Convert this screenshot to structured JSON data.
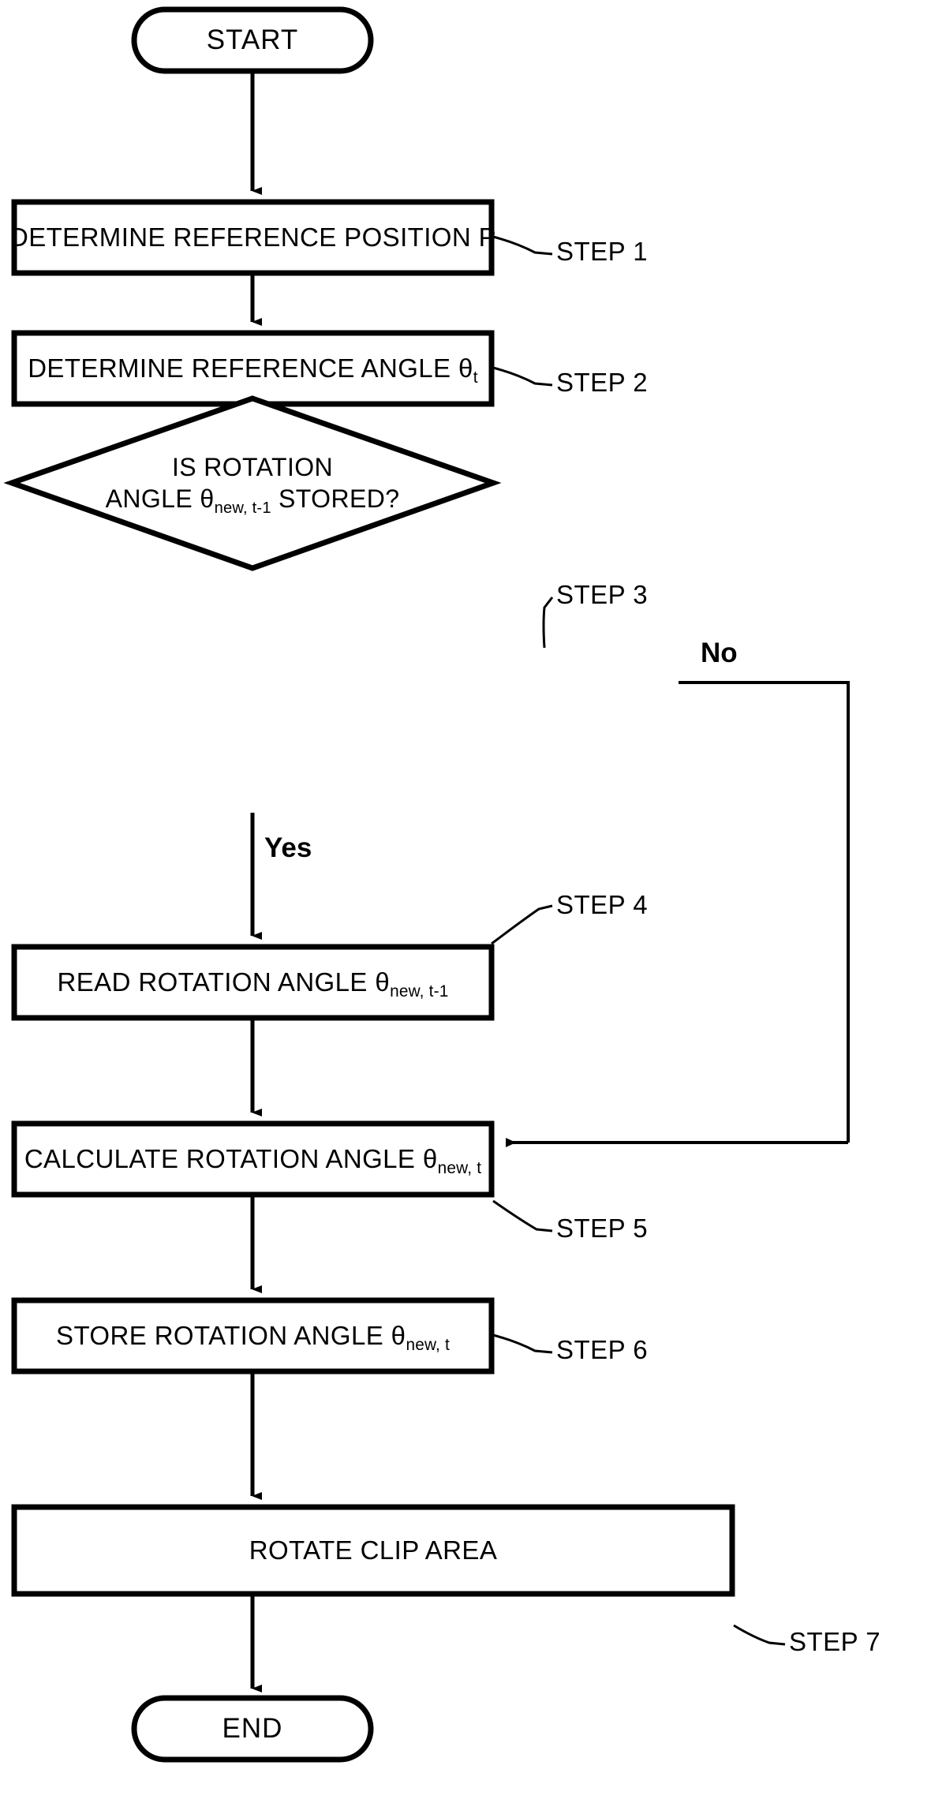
{
  "diagram": {
    "type": "flowchart",
    "title": "",
    "nodes": [
      {
        "id": "start",
        "shape": "terminator",
        "text": "START"
      },
      {
        "id": "step1",
        "shape": "process",
        "text": "DETERMINE REFERENCE POSITION P",
        "step_label": "STEP 1"
      },
      {
        "id": "step2",
        "shape": "process",
        "text_prefix": "DETERMINE REFERENCE ANGLE θ",
        "text_sub": "t",
        "step_label": "STEP 2"
      },
      {
        "id": "step3",
        "shape": "decision",
        "line1": "IS ROTATION",
        "line2_prefix": "ANGLE θ",
        "line2_sub": "new, t-1",
        "line2_suffix": " STORED?",
        "step_label": "STEP 3",
        "branch_yes": "Yes",
        "branch_no": "No"
      },
      {
        "id": "step4",
        "shape": "process",
        "text_prefix": "READ ROTATION ANGLE θ",
        "text_sub": "new, t-1",
        "step_label": "STEP 4"
      },
      {
        "id": "step5",
        "shape": "process",
        "text_prefix": "CALCULATE ROTATION ANGLE θ",
        "text_sub": "new, t",
        "step_label": "STEP 5"
      },
      {
        "id": "step6",
        "shape": "process",
        "text_prefix": "STORE ROTATION ANGLE θ",
        "text_sub": "new, t",
        "step_label": "STEP 6"
      },
      {
        "id": "step7",
        "shape": "process",
        "text": "ROTATE CLIP AREA",
        "step_label": "STEP 7"
      },
      {
        "id": "end",
        "shape": "terminator",
        "text": "END"
      }
    ],
    "edges": [
      {
        "from": "start",
        "to": "step1",
        "label": ""
      },
      {
        "from": "step1",
        "to": "step2",
        "label": ""
      },
      {
        "from": "step2",
        "to": "step3",
        "label": ""
      },
      {
        "from": "step3",
        "to": "step4",
        "label": "Yes"
      },
      {
        "from": "step3",
        "to": "step5",
        "label": "No"
      },
      {
        "from": "step4",
        "to": "step5",
        "label": ""
      },
      {
        "from": "step5",
        "to": "step6",
        "label": ""
      },
      {
        "from": "step6",
        "to": "step7",
        "label": ""
      },
      {
        "from": "step7",
        "to": "end",
        "label": ""
      }
    ],
    "colors": {
      "stroke": "#000000",
      "fill": "#ffffff",
      "text": "#000000"
    }
  }
}
